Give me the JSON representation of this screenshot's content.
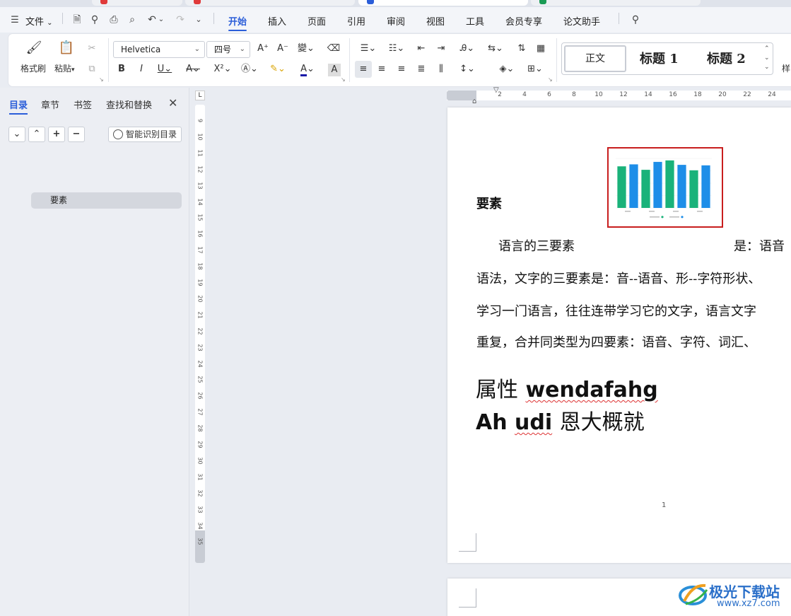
{
  "menubar": {
    "file_label": "文件",
    "tabs": [
      "开始",
      "插入",
      "页面",
      "引用",
      "审阅",
      "视图",
      "工具",
      "会员专享",
      "论文助手"
    ],
    "active_tab": "开始"
  },
  "ribbon": {
    "format_painter": "格式刷",
    "paste": "粘贴",
    "font_name": "Helvetica",
    "font_size": "四号",
    "styles": [
      "正文",
      "标题 1",
      "标题 2"
    ],
    "more_styles_label": "样"
  },
  "navpanel": {
    "tabs": [
      "目录",
      "章节",
      "书签",
      "查找和替换"
    ],
    "active_tab": "目录",
    "smart_toc_label": "智能识别目录",
    "toc_items": [
      "要素"
    ]
  },
  "rulers": {
    "horizontal_ticks": [
      "2",
      "4",
      "6",
      "8",
      "10",
      "12",
      "14",
      "16",
      "18",
      "20",
      "22",
      "24"
    ],
    "vertical_ticks": [
      "9",
      "10",
      "11",
      "12",
      "13",
      "14",
      "15",
      "16",
      "17",
      "18",
      "19",
      "20",
      "21",
      "22",
      "23",
      "24",
      "25",
      "26",
      "27",
      "28",
      "29",
      "30",
      "31",
      "32",
      "33",
      "34",
      "35"
    ],
    "corner_label": "L"
  },
  "document": {
    "heading": "要素",
    "para_line1_left": "语言的三要素",
    "para_line1_right": "是：语音",
    "para_line2": "语法，文字的三要素是：音--语音、形--字符形状、",
    "para_line3": "学习一门语言，往往连带学习它的文字，语言文字",
    "para_line4": "重复，合并同类型为四要素：语音、字符、词汇、",
    "big_line1_cn": "属性",
    "big_line1_en": "wendafahg",
    "big_line2_en1": "Ah",
    "big_line2_en2": "udi",
    "big_line2_cn": "恩大概就",
    "page_number": "1"
  },
  "chart_data": {
    "type": "bar",
    "series": [
      {
        "values": [
          84,
          88,
          77,
          93,
          96,
          87,
          76,
          86
        ],
        "color": "#1ab27a"
      },
      {
        "values": [],
        "color": "#1e8ee8"
      }
    ],
    "bar_colors": [
      "#1ab27a",
      "#1e8ee8",
      "#1ab27a",
      "#1e8ee8",
      "#1ab27a",
      "#1e8ee8",
      "#1ab27a",
      "#1e8ee8"
    ],
    "ylim": [
      0,
      100
    ],
    "selection_color": "#c81e1e"
  },
  "watermark": {
    "title": "极光下载站",
    "url": "www.xz7.com"
  }
}
